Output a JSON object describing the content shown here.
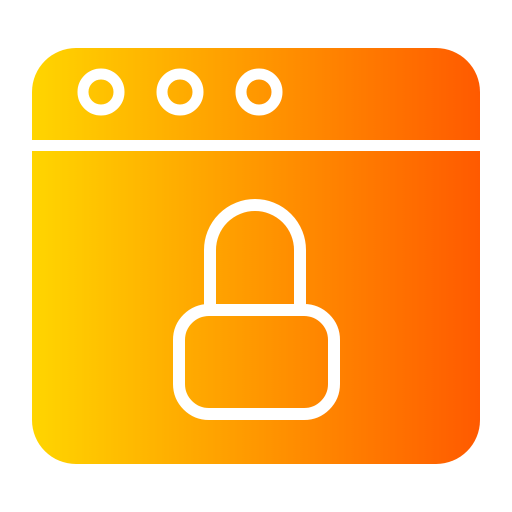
{
  "icon": {
    "name": "secure-browser-lock-icon",
    "gradient": {
      "start": "#FFD500",
      "end": "#FF5A00"
    },
    "stroke_color": "#FFFFFF"
  }
}
